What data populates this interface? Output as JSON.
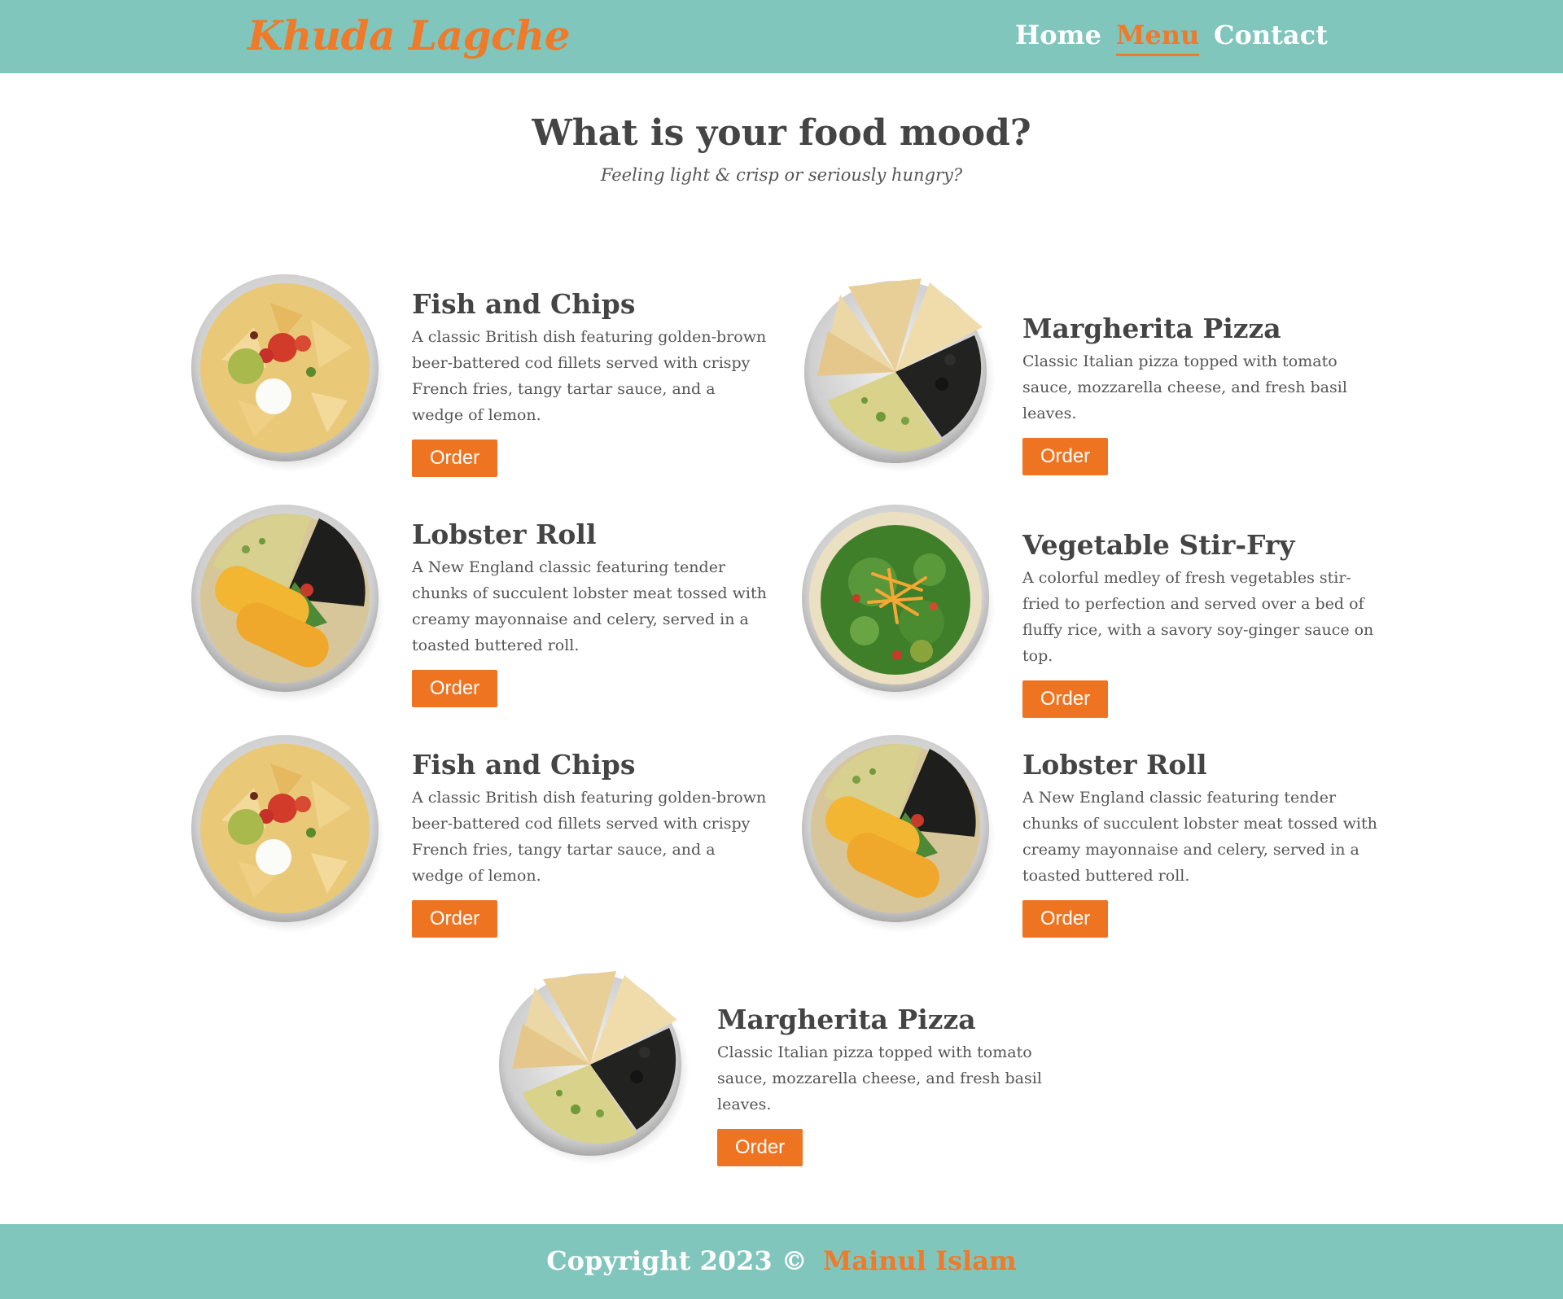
{
  "header": {
    "brand": "Khuda Lagche",
    "nav": [
      {
        "label": "Home",
        "active": false
      },
      {
        "label": "Menu",
        "active": true
      },
      {
        "label": "Contact",
        "active": false
      }
    ]
  },
  "hero": {
    "title": "What is your food mood?",
    "subtitle": "Feeling light & crisp or seriously hungry?"
  },
  "dishes": [
    {
      "name": "Fish and Chips",
      "description": "A classic British dish featuring golden-brown beer-battered cod fillets served with crispy French fries, tangy tartar sauce, and a wedge of lemon.",
      "button": "Order",
      "image": "nachos-bowl"
    },
    {
      "name": "Margherita Pizza",
      "description": "Classic Italian pizza topped with tomato sauce, mozzarella cheese, and fresh basil leaves.",
      "button": "Order",
      "image": "quesadilla-bowl"
    },
    {
      "name": "Lobster Roll",
      "description": "A New England classic featuring tender chunks of succulent lobster meat tossed with creamy mayonnaise and celery, served in a toasted buttered roll.",
      "button": "Order",
      "image": "enchilada-bowl"
    },
    {
      "name": "Vegetable Stir-Fry",
      "description": "A colorful medley of fresh vegetables stir-fried to perfection and served over a bed of fluffy rice, with a savory soy-ginger sauce on top.",
      "button": "Order",
      "image": "salad-bowl"
    },
    {
      "name": "Fish and Chips",
      "description": "A classic British dish featuring golden-brown beer-battered cod fillets served with crispy French fries, tangy tartar sauce, and a wedge of lemon.",
      "button": "Order",
      "image": "nachos-bowl"
    },
    {
      "name": "Lobster Roll",
      "description": "A New England classic featuring tender chunks of succulent lobster meat tossed with creamy mayonnaise and celery, served in a toasted buttered roll.",
      "button": "Order",
      "image": "enchilada-bowl"
    },
    {
      "name": "Margherita Pizza",
      "description": "Classic Italian pizza topped with tomato sauce, mozzarella cheese, and fresh basil leaves.",
      "button": "Order",
      "image": "quesadilla-bowl"
    }
  ],
  "footer": {
    "copyright": "Copyright 2023 ©",
    "author": "Mainul Islam"
  },
  "colors": {
    "teal": "#80c6bd",
    "orange": "#ee7a2a",
    "text": "#444444"
  }
}
